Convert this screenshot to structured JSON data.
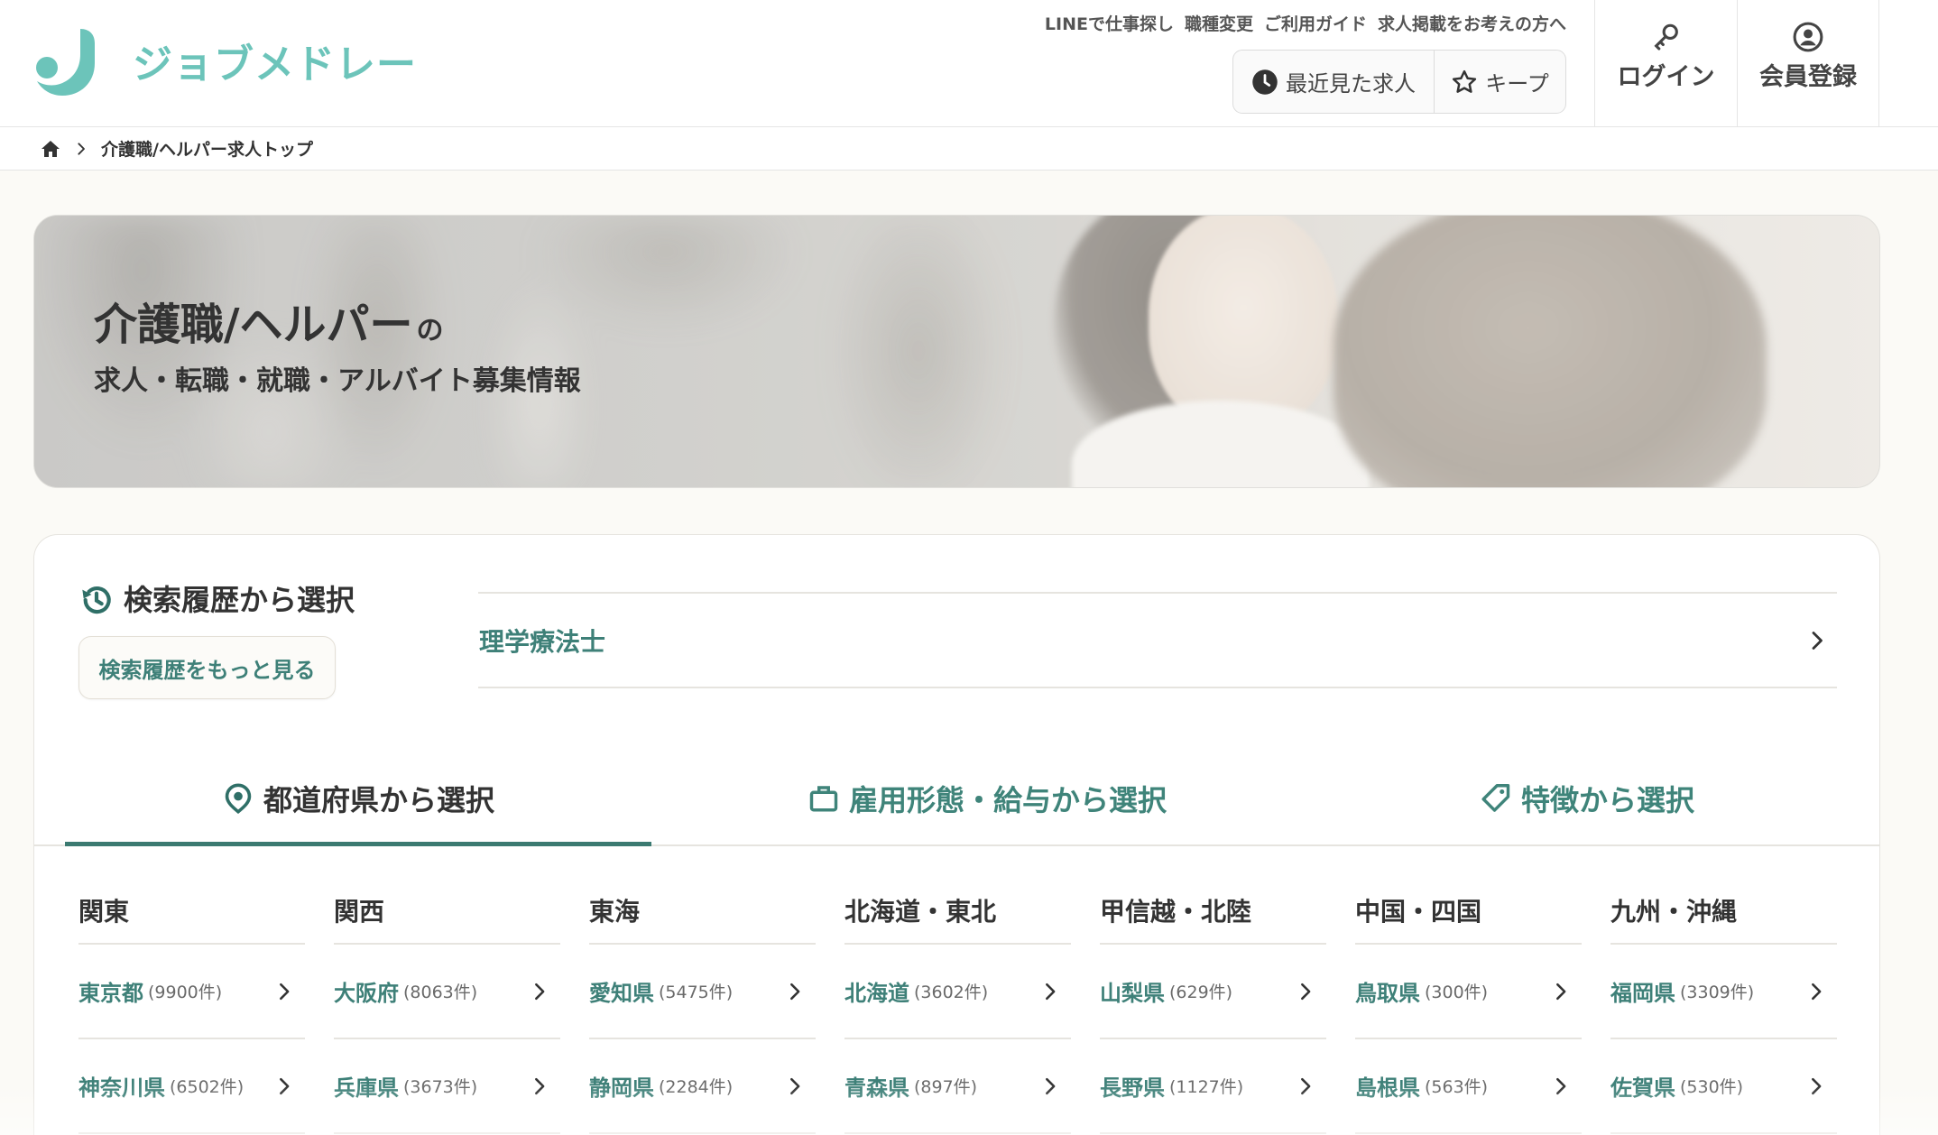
{
  "header": {
    "logo_text": "ジョブメドレー",
    "top_links": [
      "LINEで仕事探し",
      "職種変更",
      "ご利用ガイド",
      "求人掲載をお考えの方へ"
    ],
    "recent_jobs_label": "最近見た求人",
    "keep_label": "キープ",
    "login_label": "ログイン",
    "register_label": "会員登録"
  },
  "breadcrumb": {
    "current": "介護職/ヘルパー求人トップ"
  },
  "hero": {
    "title_main": "介護職/ヘルパー",
    "title_particle": "の",
    "subtitle": "求人・転職・就職・アルバイト募集情報"
  },
  "search_history": {
    "heading": "検索履歴から選択",
    "more_label": "検索履歴をもっと見る",
    "items": [
      {
        "label": "理学療法士"
      }
    ]
  },
  "tabs": [
    {
      "label": "都道府県から選択",
      "icon": "map-pin-icon",
      "active": true
    },
    {
      "label": "雇用形態・給与から選択",
      "icon": "briefcase-icon",
      "active": false
    },
    {
      "label": "特徴から選択",
      "icon": "tag-icon",
      "active": false
    }
  ],
  "regions": [
    {
      "name": "関東",
      "prefectures": [
        {
          "name": "東京都",
          "count": "(9900件)"
        },
        {
          "name": "神奈川県",
          "count": "(6502件)"
        }
      ]
    },
    {
      "name": "関西",
      "prefectures": [
        {
          "name": "大阪府",
          "count": "(8063件)"
        },
        {
          "name": "兵庫県",
          "count": "(3673件)"
        }
      ]
    },
    {
      "name": "東海",
      "prefectures": [
        {
          "name": "愛知県",
          "count": "(5475件)"
        },
        {
          "name": "静岡県",
          "count": "(2284件)"
        }
      ]
    },
    {
      "name": "北海道・東北",
      "prefectures": [
        {
          "name": "北海道",
          "count": "(3602件)"
        },
        {
          "name": "青森県",
          "count": "(897件)"
        }
      ]
    },
    {
      "name": "甲信越・北陸",
      "prefectures": [
        {
          "name": "山梨県",
          "count": "(629件)"
        },
        {
          "name": "長野県",
          "count": "(1127件)"
        }
      ]
    },
    {
      "name": "中国・四国",
      "prefectures": [
        {
          "name": "鳥取県",
          "count": "(300件)"
        },
        {
          "name": "島根県",
          "count": "(563件)"
        }
      ]
    },
    {
      "name": "九州・沖縄",
      "prefectures": [
        {
          "name": "福岡県",
          "count": "(3309件)"
        },
        {
          "name": "佐賀県",
          "count": "(530件)"
        }
      ]
    }
  ],
  "colors": {
    "brand": "#6cc4ba",
    "link": "#3e8078",
    "text": "#333333",
    "active_tab_underline": "#3b7a71",
    "page_background": "#fbfaf6"
  },
  "icons": {
    "logo": "logo-icon",
    "recent": "clock-icon",
    "keep": "star-icon",
    "login": "key-icon",
    "register": "user-circle-icon",
    "breadcrumb_home": "home-icon",
    "history": "history-icon",
    "row_arrow": "chevron-right-icon"
  }
}
